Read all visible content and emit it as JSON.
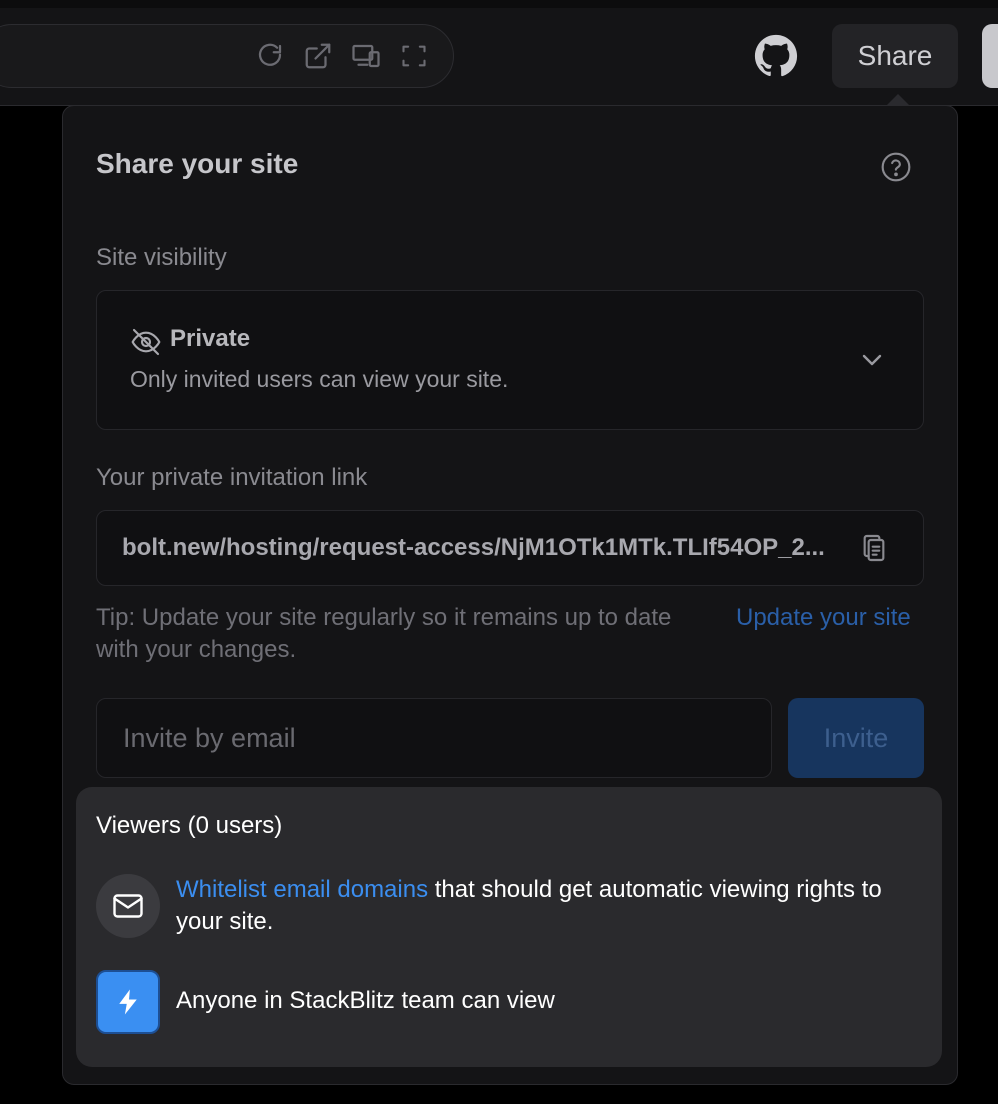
{
  "toolbar": {
    "icons": [
      "refresh-icon",
      "external-link-icon",
      "responsive-devices-icon",
      "fullscreen-icon",
      "github-icon"
    ],
    "share_label": "Share"
  },
  "share_panel": {
    "title": "Share your site",
    "visibility": {
      "label": "Site visibility",
      "selected_title": "Private",
      "selected_description": "Only invited users can view your site."
    },
    "invitation": {
      "label": "Your private invitation link",
      "link": "bolt.new/hosting/request-access/NjM1OTk1MTk.TLIf54OP_2..."
    },
    "tip_text": "Tip: Update your site regularly so it remains up to date with your changes.",
    "update_link": "Update your site",
    "invite": {
      "placeholder": "Invite by email",
      "value": "",
      "button_label": "Invite"
    },
    "viewers": {
      "title": "Viewers (0 users)",
      "whitelist_link": "Whitelist email domains",
      "whitelist_rest": " that should get automatic viewing rights to your site.",
      "team_text": "Anyone in StackBlitz team can view"
    }
  },
  "colors": {
    "accent": "#3b8ef0",
    "panel_bg": "#141416",
    "viewers_bg": "#2a2a2d",
    "invite_button_bg": "#17355e"
  }
}
